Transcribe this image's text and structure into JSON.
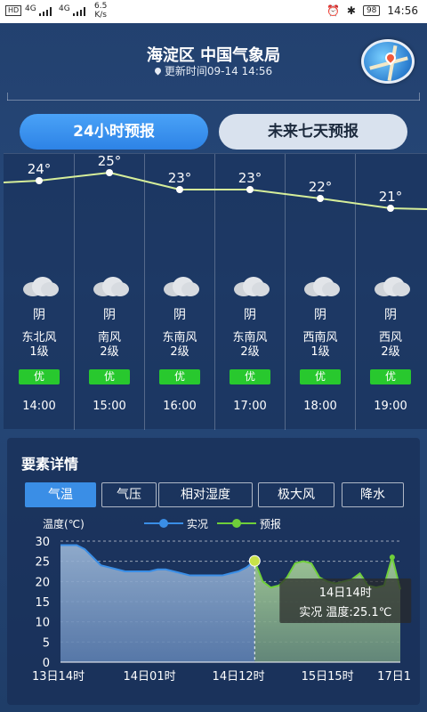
{
  "status_bar": {
    "hd": "HD",
    "sim1": "4G",
    "sim2": "4G",
    "speed_value": "6.5",
    "speed_unit": "K/s",
    "battery": "98",
    "time": "14:56"
  },
  "header": {
    "title": "海淀区 中国气象局",
    "update_time": "更新时间09-14 14:56"
  },
  "tabs": {
    "hourly": "24小时预报",
    "weekly": "未来七天预报"
  },
  "hourly": [
    {
      "temp": "24°",
      "temp_value": 24,
      "condition": "阴",
      "wind_dir": "东北风",
      "wind_level": "1级",
      "aqi": "优",
      "time": "14:00"
    },
    {
      "temp": "25°",
      "temp_value": 25,
      "condition": "阴",
      "wind_dir": "南风",
      "wind_level": "2级",
      "aqi": "优",
      "time": "15:00"
    },
    {
      "temp": "23°",
      "temp_value": 23,
      "condition": "阴",
      "wind_dir": "东南风",
      "wind_level": "2级",
      "aqi": "优",
      "time": "16:00"
    },
    {
      "temp": "23°",
      "temp_value": 23,
      "condition": "阴",
      "wind_dir": "东南风",
      "wind_level": "2级",
      "aqi": "优",
      "time": "17:00"
    },
    {
      "temp": "22°",
      "temp_value": 22,
      "condition": "阴",
      "wind_dir": "西南风",
      "wind_level": "1级",
      "aqi": "优",
      "time": "18:00"
    },
    {
      "temp": "21°",
      "temp_value": 21,
      "condition": "阴",
      "wind_dir": "西风",
      "wind_level": "2级",
      "aqi": "优",
      "time": "19:00"
    }
  ],
  "detail": {
    "title": "要素详情",
    "tabs": [
      "气温",
      "气压",
      "相对湿度",
      "极大风",
      "降水"
    ],
    "active_tab": 0
  },
  "colors": {
    "actual": "#3a8ee6",
    "forecast": "#6fcf3a",
    "aqi_good": "#28c82e",
    "line": "#d6ee9a"
  },
  "chart_data": {
    "type": "area",
    "ylabel": "温度(℃)",
    "ylim": [
      0,
      30
    ],
    "yticks": [
      0,
      5,
      10,
      15,
      20,
      25,
      30
    ],
    "xticks": [
      "13日14时",
      "14日01时",
      "14日12时",
      "15日15时",
      "17日1"
    ],
    "legend": [
      "实况",
      "预报"
    ],
    "series": [
      {
        "name": "实况",
        "x_hours": [
          0,
          1,
          2,
          3,
          4,
          5,
          6,
          7,
          8,
          9,
          10,
          11,
          12,
          13,
          14,
          15,
          16,
          17,
          18,
          19,
          20,
          21,
          22,
          23,
          24
        ],
        "values": [
          29,
          29,
          29,
          28,
          26,
          24,
          23.5,
          23,
          22.5,
          22.5,
          22.5,
          22.5,
          23,
          23,
          22.5,
          22,
          21.5,
          21.5,
          21.5,
          21.5,
          21.5,
          22,
          22.5,
          23.5,
          25.1
        ]
      },
      {
        "name": "预报",
        "x_hours": [
          24,
          25,
          26,
          27,
          28,
          29,
          30,
          31,
          32,
          33,
          34,
          35,
          36,
          37,
          38,
          39,
          40,
          41,
          42
        ],
        "values": [
          25.1,
          20,
          18.5,
          19,
          21,
          24.5,
          25,
          24.5,
          21,
          20,
          19.5,
          20,
          20.5,
          22,
          19,
          18.5,
          19,
          26,
          18
        ]
      }
    ],
    "tooltip": {
      "title": "14日14时",
      "text": "实况 温度:25.1℃"
    }
  }
}
